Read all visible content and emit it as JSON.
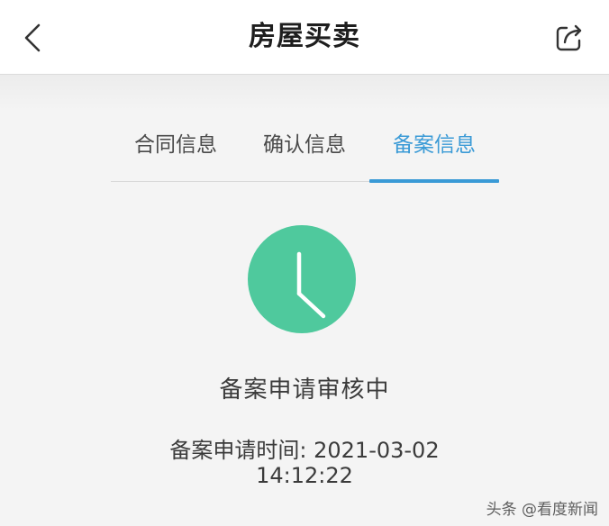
{
  "header": {
    "title": "房屋买卖",
    "back_icon": "chevron-left-icon",
    "share_icon": "share-icon"
  },
  "tabs": [
    {
      "label": "合同信息",
      "active": false
    },
    {
      "label": "确认信息",
      "active": false
    },
    {
      "label": "备案信息",
      "active": true
    }
  ],
  "status": {
    "icon": "clock-icon",
    "text": "备案申请审核中",
    "time_label": "备案申请时间: ",
    "date": "2021-03-02",
    "time": "14:12:22"
  },
  "watermark": "头条 @看度新闻",
  "colors": {
    "accent": "#3a9ad6",
    "clock": "#4fc99d"
  }
}
